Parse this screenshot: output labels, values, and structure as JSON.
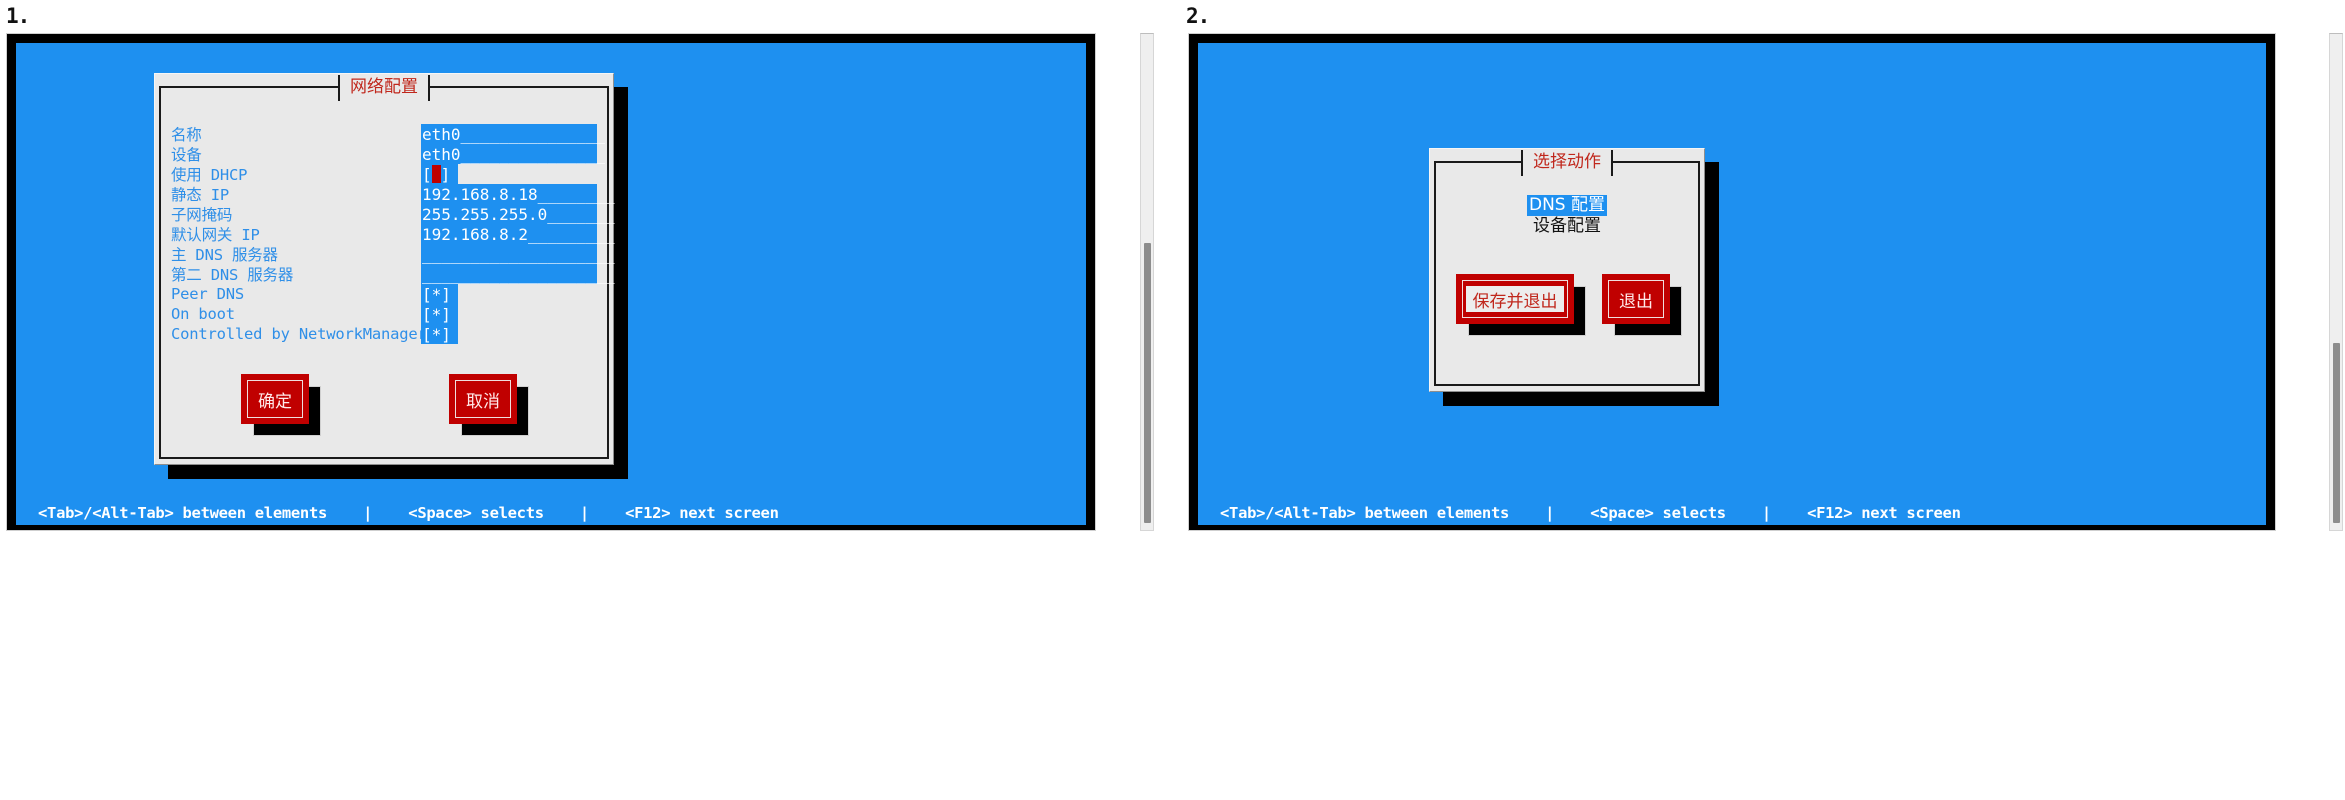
{
  "panels": [
    {
      "number": "1.",
      "dialog_title": "网络配置",
      "form_rows": [
        {
          "label": "名称",
          "type": "text",
          "value": "eth0_______________"
        },
        {
          "label": "设备",
          "type": "text",
          "value": "eth0_______________"
        },
        {
          "label": "使用 DHCP",
          "type": "checkbox_cursor",
          "value": "[ ]"
        },
        {
          "label": "静态 IP",
          "type": "text",
          "value": "192.168.8.18________"
        },
        {
          "label": "子网掩码",
          "type": "text",
          "value": "255.255.255.0_______"
        },
        {
          "label": "默认网关 IP",
          "type": "text",
          "value": "192.168.8.2_________"
        },
        {
          "label": "主 DNS 服务器",
          "type": "text",
          "value": "____________________"
        },
        {
          "label": "第二 DNS 服务器",
          "type": "text",
          "value": "____________________"
        },
        {
          "label": "Peer DNS",
          "type": "checkbox",
          "value": "[*]"
        },
        {
          "label": "On boot",
          "type": "checkbox",
          "value": "[*]"
        },
        {
          "label": "Controlled by NetworkManager",
          "type": "checkbox",
          "value": "[*]"
        }
      ],
      "buttons": [
        {
          "label": "确定",
          "focused": false
        },
        {
          "label": "取消",
          "focused": false
        }
      ],
      "status_bar": "<Tab>/<Alt-Tab> between elements    |    <Space> selects    |    <F12> next screen"
    },
    {
      "number": "2.",
      "dialog_title": "选择动作",
      "list_items": [
        {
          "label": "DNS 配置",
          "selected": true
        },
        {
          "label": "设备配置",
          "selected": false
        }
      ],
      "buttons": [
        {
          "label": "保存并退出",
          "focused": true
        },
        {
          "label": "退出",
          "focused": false
        }
      ],
      "status_bar": "<Tab>/<Alt-Tab> between elements    |    <Space> selects    |    <F12> next screen"
    }
  ],
  "colors": {
    "terminal_blue": "#1e90f0",
    "dialog_gray": "#e9e9e9",
    "button_red": "#c00000",
    "title_red": "#c0271c",
    "label_blue": "#2f8fe8",
    "cursor_red": "#c00000",
    "shadow_black": "#000000"
  },
  "scrollbars": [
    {
      "name": "panel-1-vertical-scrollbar",
      "thumb_top_ratio": 0.42
    },
    {
      "name": "panel-2-vertical-scrollbar",
      "thumb_top_ratio": 0.62
    }
  ]
}
